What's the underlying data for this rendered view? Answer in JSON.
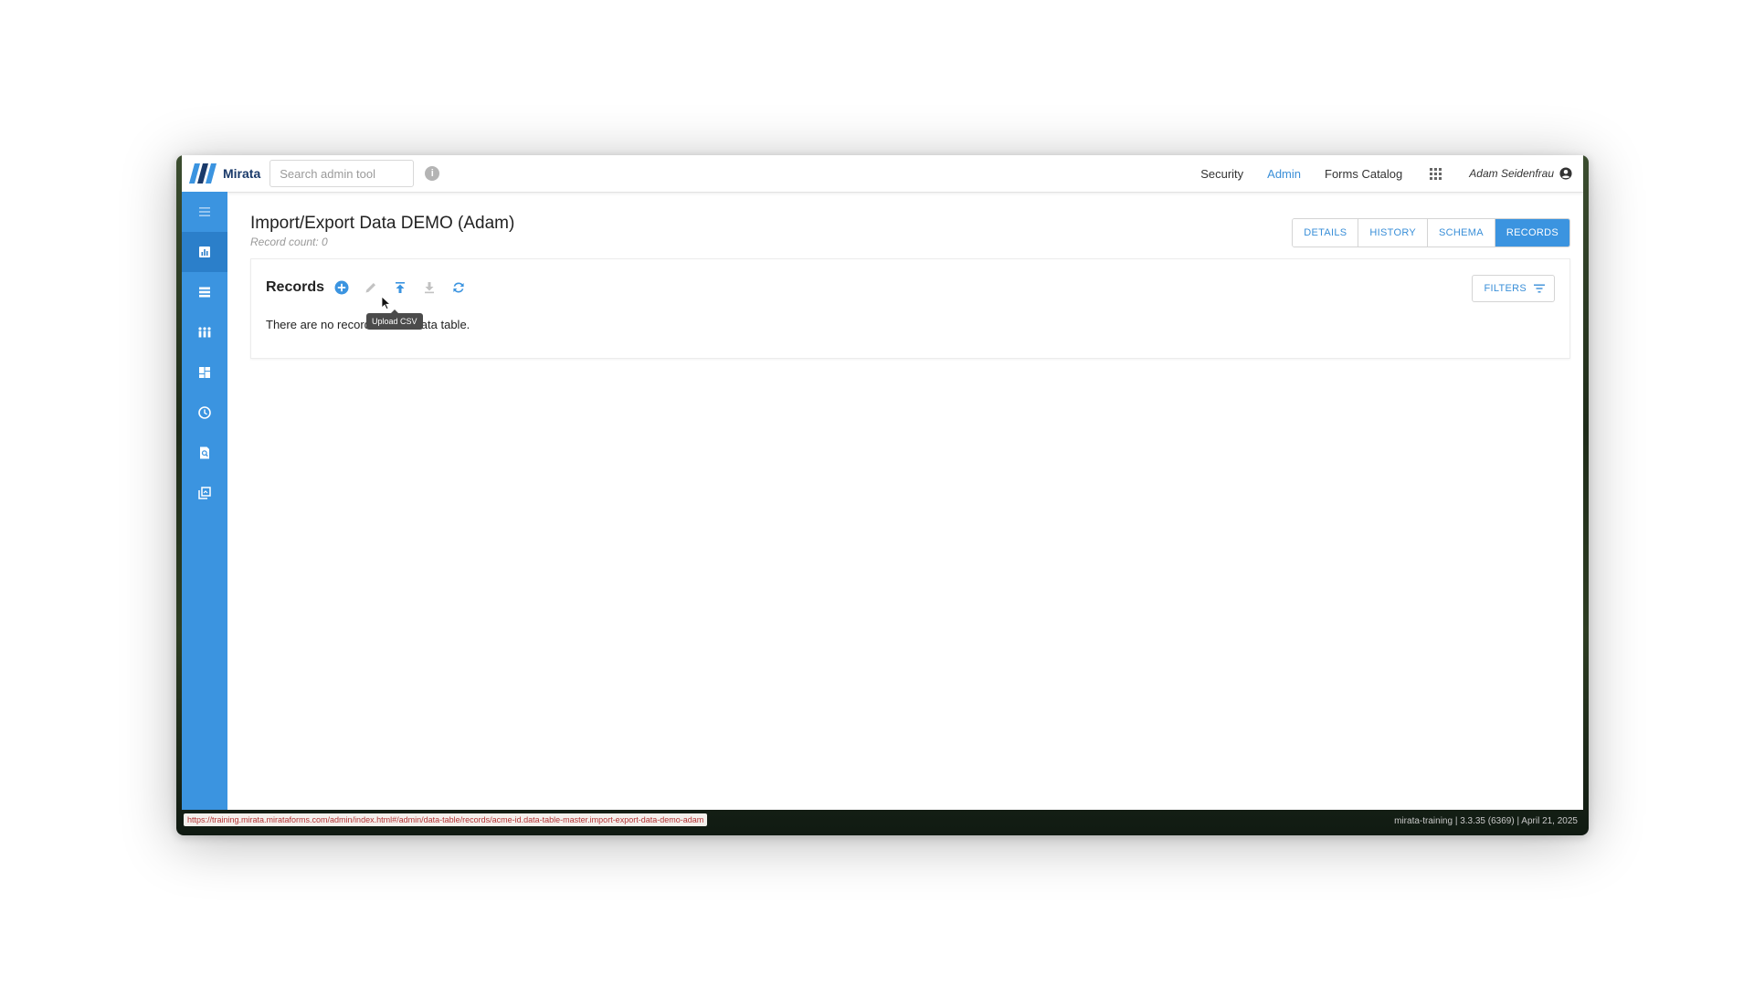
{
  "brand": {
    "name": "Mirata"
  },
  "search": {
    "placeholder": "Search admin tool"
  },
  "nav": {
    "items": [
      {
        "label": "Security",
        "active": false
      },
      {
        "label": "Admin",
        "active": true
      },
      {
        "label": "Forms Catalog",
        "active": false
      }
    ],
    "user_name": "Adam Seidenfrau"
  },
  "sidebar": {
    "items": [
      {
        "icon": "menu-icon"
      },
      {
        "icon": "chart-icon",
        "active": true
      },
      {
        "icon": "list-icon"
      },
      {
        "icon": "people-icon"
      },
      {
        "icon": "dashboard-icon"
      },
      {
        "icon": "clock-icon"
      },
      {
        "icon": "search-document-icon"
      },
      {
        "icon": "library-icon"
      }
    ]
  },
  "page": {
    "title": "Import/Export Data DEMO (Adam)",
    "subtitle": "Record count: 0",
    "tabs": [
      {
        "label": "DETAILS",
        "active": false
      },
      {
        "label": "HISTORY",
        "active": false
      },
      {
        "label": "SCHEMA",
        "active": false
      },
      {
        "label": "RECORDS",
        "active": true
      }
    ]
  },
  "records": {
    "title": "Records",
    "empty_text": "There are no records in this data table.",
    "tooltip": "Upload CSV",
    "filters_label": "FILTERS"
  },
  "status": {
    "url": "https://training.mirata.mirataforms.com/admin/index.html#/admin/data-table/records/acme-id.data-table-master.import-export-data-demo-adam",
    "version": "mirata-training | 3.3.35 (6369) | April 21, 2025"
  },
  "colors": {
    "accent": "#3b94e0",
    "link": "#3a8fd8",
    "brand": "#1a3a6a"
  }
}
